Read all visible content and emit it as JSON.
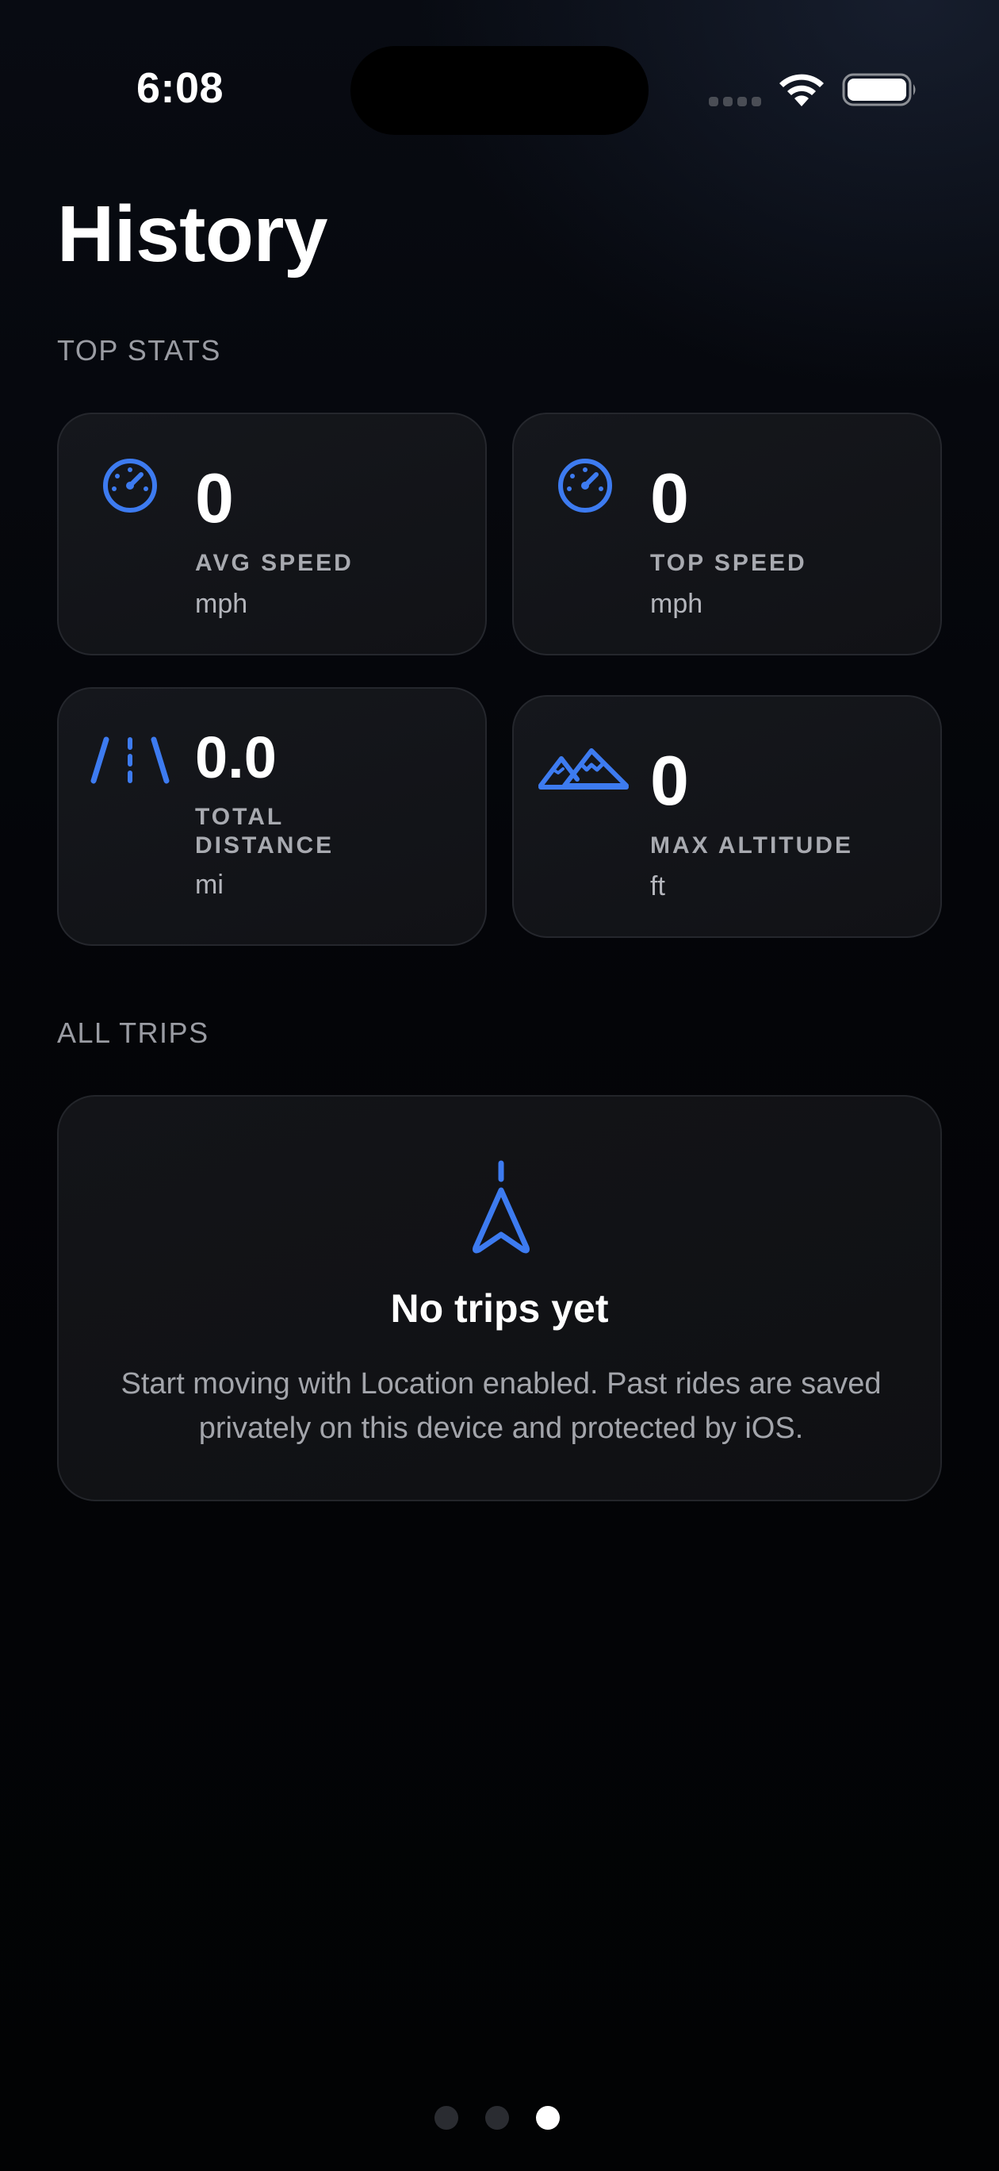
{
  "status_bar": {
    "time": "6:08"
  },
  "page": {
    "title": "History"
  },
  "top_stats": {
    "header": "TOP STATS",
    "cards": [
      {
        "icon": "speedometer-icon",
        "value": "0",
        "label": "AVG SPEED",
        "unit": "mph"
      },
      {
        "icon": "speedometer-icon",
        "value": "0",
        "label": "TOP SPEED",
        "unit": "mph"
      },
      {
        "icon": "road-icon",
        "value": "0.0",
        "label": "TOTAL DISTANCE",
        "unit": "mi"
      },
      {
        "icon": "mountains-icon",
        "value": "0",
        "label": "MAX ALTITUDE",
        "unit": "ft"
      }
    ]
  },
  "all_trips": {
    "header": "ALL TRIPS",
    "empty_icon": "location-arrow-icon",
    "empty_title": "No trips yet",
    "empty_text": "Start moving with Location enabled. Past rides are saved privately on this device and protected by iOS."
  },
  "pager": {
    "count": 3,
    "active_index": 2
  },
  "colors": {
    "accent": "#3d7bf0",
    "background": "#020305",
    "card": "#131418",
    "secondary_text": "#a3a5ab"
  }
}
